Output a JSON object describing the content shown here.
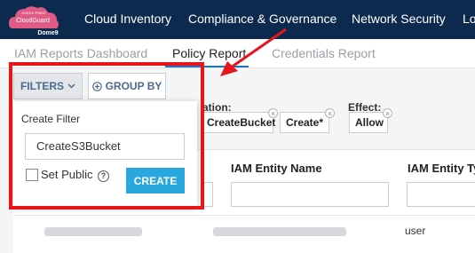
{
  "logo": {
    "line1": "CHECK POINT",
    "line2": "CloudGuard",
    "line3": "Dome9"
  },
  "nav": [
    "Cloud Inventory",
    "Compliance & Governance",
    "Network Security",
    "Lo"
  ],
  "tabs": [
    "IAM Reports Dashboard",
    "Policy Report",
    "Credentials Report"
  ],
  "active_tab": "Policy Report",
  "toolbar": {
    "filters_label": "FILTERS",
    "group_by_label": "GROUP BY"
  },
  "chips": {
    "action_label": "ation:",
    "action_values": [
      "CreateBucket",
      "Create*"
    ],
    "effect_label": "Effect:",
    "effect_value": "Allow"
  },
  "table": {
    "headers": [
      "IAM Entity Name",
      "IAM Entity Typ"
    ],
    "row1_type": "user"
  },
  "create_filter": {
    "title": "Create Filter",
    "input_value": "CreateS3Bucket",
    "set_public_label": "Set Public",
    "set_public_checked": false,
    "help_glyph": "?",
    "create_label": "CREATE"
  },
  "colors": {
    "nav_bg": "#0c2a4d",
    "accent": "#29a8e0",
    "annotation": "#e8141c",
    "tab_underline": "#1d76c0"
  }
}
